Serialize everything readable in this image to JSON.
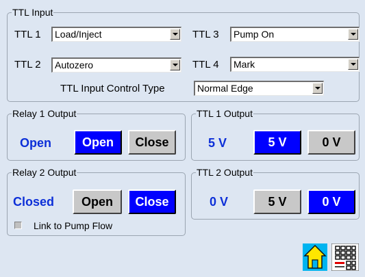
{
  "ttl_input": {
    "title": "TTL Input",
    "ttl1": {
      "label": "TTL 1",
      "value": "Load/Inject"
    },
    "ttl2": {
      "label": "TTL 2",
      "value": "Autozero"
    },
    "ttl3": {
      "label": "TTL 3",
      "value": "Pump On"
    },
    "ttl4": {
      "label": "TTL 4",
      "value": "Mark"
    },
    "control_type": {
      "label": "TTL Input Control Type",
      "value": "Normal Edge"
    }
  },
  "relay1": {
    "title": "Relay 1 Output",
    "status": "Open",
    "open_label": "Open",
    "close_label": "Close",
    "active": "open"
  },
  "relay2": {
    "title": "Relay 2 Output",
    "status": "Closed",
    "open_label": "Open",
    "close_label": "Close",
    "active": "close",
    "link_label": "Link to Pump Flow",
    "link_checked": false
  },
  "ttl1_output": {
    "title": "TTL 1 Output",
    "status": "5 V",
    "high_label": "5 V",
    "low_label": "0 V",
    "active": "high"
  },
  "ttl2_output": {
    "title": "TTL 2 Output",
    "status": "0 V",
    "high_label": "5 V",
    "low_label": "0 V",
    "active": "low"
  },
  "toolbar": {
    "home_icon": "home-icon",
    "keypad_icon": "keypad-icon"
  },
  "colors": {
    "background": "#dde6f2",
    "active_button": "#0000ff",
    "status_text": "#0c2fd8"
  }
}
